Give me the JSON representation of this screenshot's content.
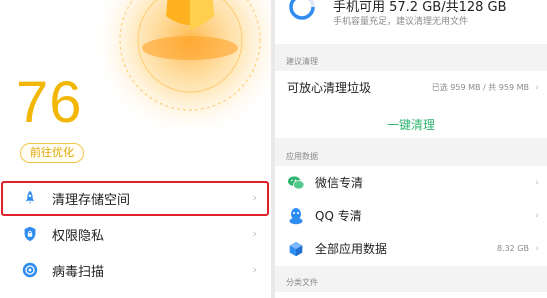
{
  "left": {
    "score": "76",
    "optimize_label": "前往优化",
    "menu": [
      {
        "label": "清理存储空间",
        "icon": "rocket-icon"
      },
      {
        "label": "权限隐私",
        "icon": "shield-lock-icon"
      },
      {
        "label": "病毒扫描",
        "icon": "virus-scan-icon"
      }
    ]
  },
  "right": {
    "storage": {
      "title": "手机可用 57.2 GB/共128 GB",
      "subtitle": "手机容量充足，建议清理无用文件"
    },
    "suggest_section": {
      "header": "建议清理",
      "item_label": "可放心清理垃圾",
      "item_meta": "已选 959 MB / 共 959 MB",
      "action_label": "一键清理"
    },
    "app_section": {
      "header": "应用数据",
      "items": [
        {
          "label": "微信专清",
          "meta": "",
          "icon": "wechat-icon"
        },
        {
          "label": "QQ 专清",
          "meta": "",
          "icon": "qq-icon"
        },
        {
          "label": "全部应用数据",
          "meta": "8.32 GB",
          "icon": "cube-icon"
        }
      ]
    },
    "files_section": {
      "header": "分类文件"
    }
  },
  "colors": {
    "score": "#f2b705",
    "accent_green": "#2fb56f",
    "highlight_red": "#e0202a",
    "icon_blue": "#2f8cf0"
  }
}
